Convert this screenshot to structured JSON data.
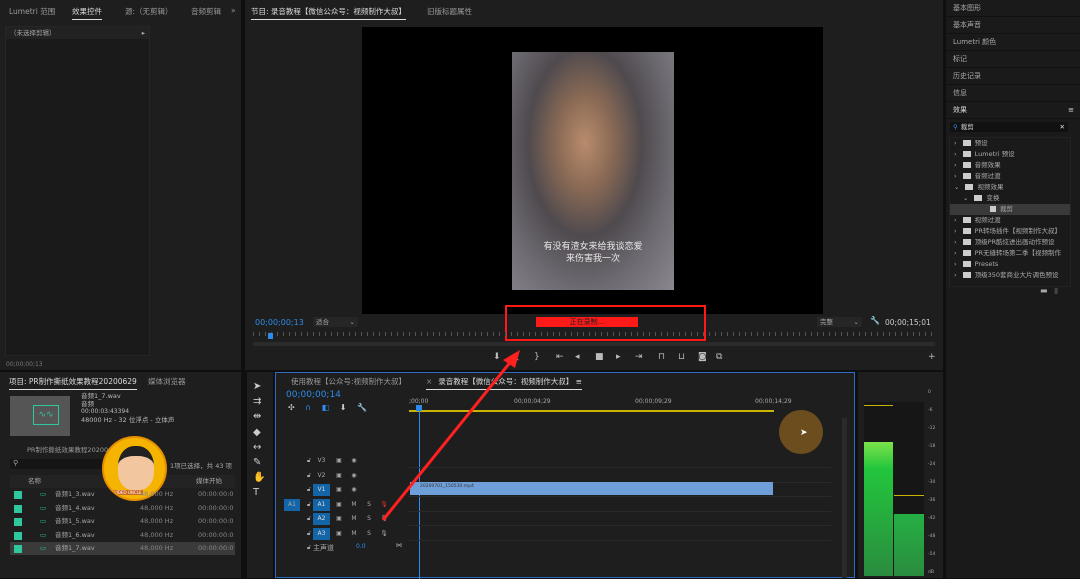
{
  "top_left": {
    "tabs": [
      "Lumetri 范围",
      "效果控件",
      "源:（无剪辑）",
      "音频剪辑"
    ],
    "overflow": "»",
    "no_clip": "（未选择剪辑）",
    "timecode": "00;00;00;13"
  },
  "program": {
    "tabs": [
      "节目: 录音教程【微信公众号：视频制作大叔】",
      "旧版标题属性"
    ],
    "subtitle_line1": "有没有渣女来给我谈恋爱",
    "subtitle_line2": "来伤害我一次",
    "timecode": "00;00;00;13",
    "zoom": "适合",
    "quality": "完整",
    "duration": "00;00;15;01",
    "recording": "正在录制..."
  },
  "right_panel": {
    "items": [
      "基本图形",
      "基本声音",
      "Lumetri 颜色",
      "标记",
      "历史记录",
      "信息"
    ],
    "effects_title": "效果",
    "search_value": "裁剪",
    "tree": [
      {
        "label": "预设",
        "indent": 0,
        "open": false
      },
      {
        "label": "Lumetri 预设",
        "indent": 0,
        "open": false
      },
      {
        "label": "音频效果",
        "indent": 0,
        "open": false
      },
      {
        "label": "音频过渡",
        "indent": 0,
        "open": false
      },
      {
        "label": "视频效果",
        "indent": 0,
        "open": true
      },
      {
        "label": "变换",
        "indent": 1,
        "open": true
      },
      {
        "label": "裁剪",
        "indent": 2,
        "selected": true
      },
      {
        "label": "视频过渡",
        "indent": 0,
        "open": false
      },
      {
        "label": "PR转场插件【视频制作大叔】",
        "indent": 0
      },
      {
        "label": "顶级PR酷炫进出画动作预设",
        "indent": 0
      },
      {
        "label": "PR无缝转场第二季【视频制作",
        "indent": 0
      },
      {
        "label": "Presets",
        "indent": 0
      },
      {
        "label": "顶级350套商业大片调色预设",
        "indent": 0
      }
    ]
  },
  "project": {
    "tabs": [
      "项目: PR制作撕纸效果教程20200629",
      "媒体浏览器"
    ],
    "clip_name": "音频1_7.wav",
    "clip_type": "音频",
    "clip_duration": "00:00:03:43394",
    "clip_format": "48000 Hz - 32 位浮点 - 立体声",
    "bin": "PR制作撕纸效果教程20200629",
    "selection": "1项已选择，共 43 项",
    "col_name": "名称",
    "col_start": "媒体开始",
    "rows": [
      {
        "name": "音频1_3.wav",
        "rate": "48,000 Hz",
        "start": "00:00:00:0"
      },
      {
        "name": "音频1_4.wav",
        "rate": "48,000 Hz",
        "start": "00:00:00:0"
      },
      {
        "name": "音频1_5.wav",
        "rate": "48,000 Hz",
        "start": "00:00:00:0"
      },
      {
        "name": "音频1_6.wav",
        "rate": "48,000 Hz",
        "start": "00:00:00:0"
      },
      {
        "name": "音频1_7.wav",
        "rate": "48,000 Hz",
        "start": "00:00:00:0"
      }
    ],
    "avatar_label": "VIDEO UNCLE"
  },
  "timeline": {
    "tabs": [
      "使用教程【公众号:视频制作大叔】",
      "录音教程【微信公众号：视频制作大叔】"
    ],
    "timecode": "00;00;00;14",
    "ruler": [
      ";00;00",
      "00;00;04;29",
      "00;00;09;29",
      "00;00;14;29"
    ],
    "tracks": [
      {
        "name": "V3"
      },
      {
        "name": "V2"
      },
      {
        "name": "V1"
      },
      {
        "name": "A1",
        "src": "A1"
      },
      {
        "name": "A2"
      },
      {
        "name": "A3"
      }
    ],
    "mute": "M",
    "solo": "S",
    "master": "主声道",
    "master_value": "0.0",
    "clip": "20200701_150530.mp4"
  },
  "meter": {
    "scale": [
      "0",
      "-6",
      "-12",
      "-18",
      "-24",
      "-30",
      "-36",
      "-42",
      "-48",
      "-54",
      "dB"
    ],
    "left_level": 0.78,
    "right_level": 0.36
  },
  "colors": {
    "accent": "#2d8ceb",
    "record": "#ff1a1a",
    "clip": "#6f9fd8",
    "audio_swatch": "#2fc79d"
  }
}
